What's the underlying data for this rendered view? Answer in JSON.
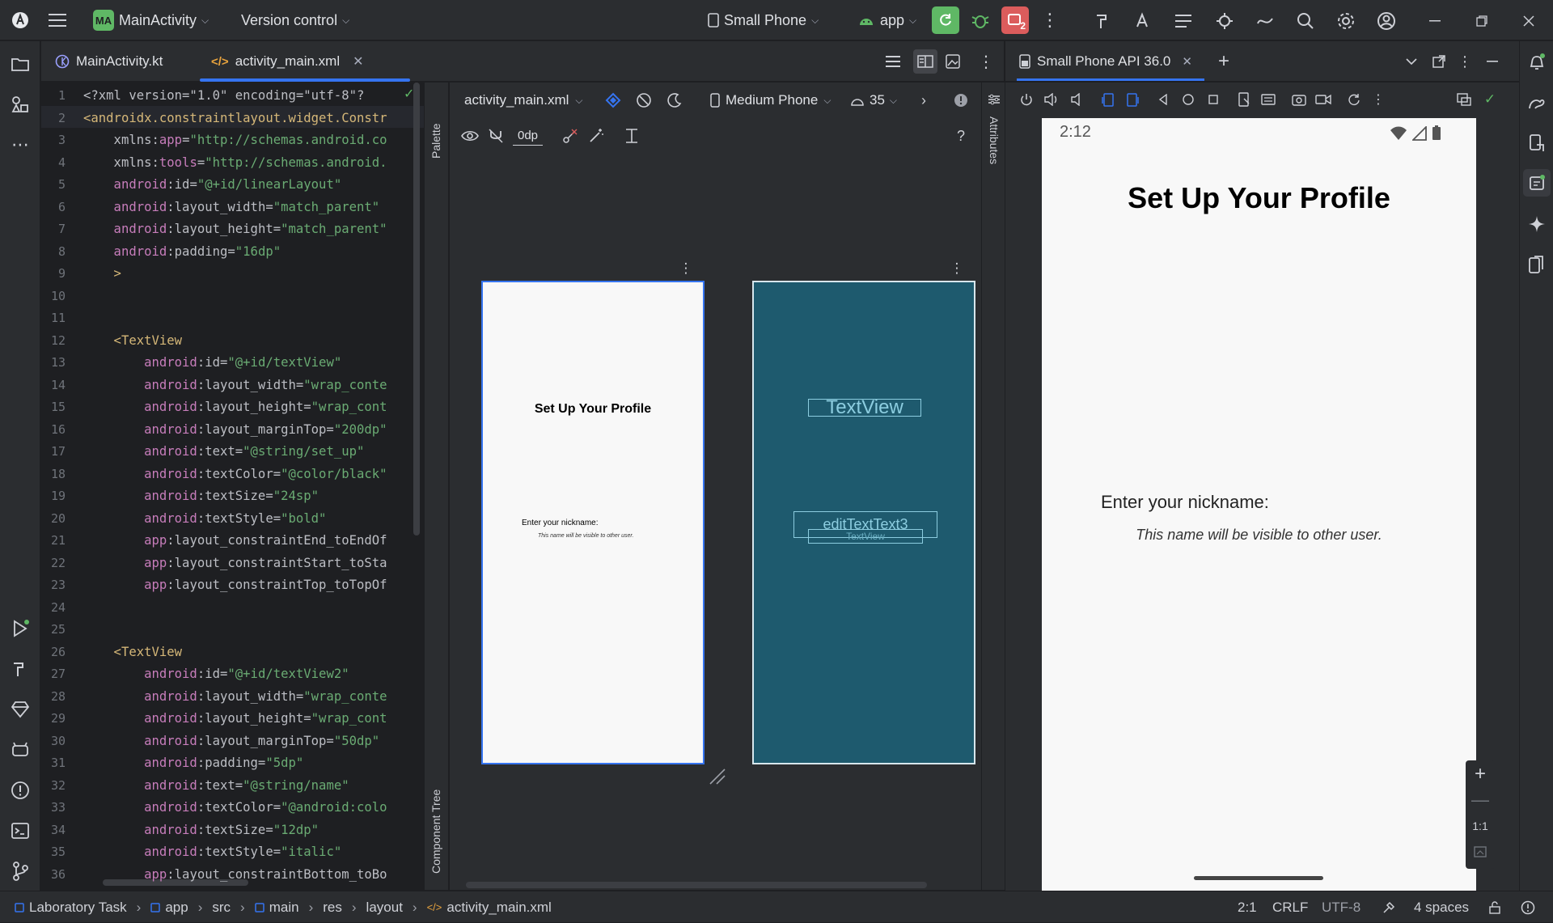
{
  "title_bar": {
    "project_badge": "MA",
    "project_name": "MainActivity",
    "vcs_label": "Version control",
    "device_label": "Small Phone",
    "run_config": "app",
    "notification_count": "2"
  },
  "editor_tabs": [
    {
      "label": "MainActivity.kt",
      "active": false
    },
    {
      "label": "activity_main.xml",
      "active": true
    }
  ],
  "code_lines": [
    {
      "n": "1",
      "parts": [
        [
          "p",
          "<?xml version=\"1.0\" encoding=\"utf-8\"?"
        ]
      ]
    },
    {
      "n": "2",
      "parts": [
        [
          "k",
          "<androidx.constraintlayout.widget.Constr"
        ]
      ]
    },
    {
      "n": "3",
      "parts": [
        [
          "p",
          "    xmlns:"
        ],
        [
          "a",
          "app"
        ],
        [
          "p",
          "="
        ],
        [
          "s",
          "\"http://schemas.android.co"
        ]
      ]
    },
    {
      "n": "4",
      "parts": [
        [
          "p",
          "    xmlns:"
        ],
        [
          "a",
          "tools"
        ],
        [
          "p",
          "="
        ],
        [
          "s",
          "\"http://schemas.android."
        ]
      ]
    },
    {
      "n": "5",
      "parts": [
        [
          "a",
          "    android"
        ],
        [
          "p",
          ":id="
        ],
        [
          "s",
          "\"@+id/linearLayout\""
        ]
      ]
    },
    {
      "n": "6",
      "parts": [
        [
          "a",
          "    android"
        ],
        [
          "p",
          ":layout_width="
        ],
        [
          "s",
          "\"match_parent\""
        ]
      ]
    },
    {
      "n": "7",
      "parts": [
        [
          "a",
          "    android"
        ],
        [
          "p",
          ":layout_height="
        ],
        [
          "s",
          "\"match_parent\""
        ]
      ]
    },
    {
      "n": "8",
      "parts": [
        [
          "a",
          "    android"
        ],
        [
          "p",
          ":padding="
        ],
        [
          "s",
          "\"16dp\""
        ]
      ]
    },
    {
      "n": "9",
      "parts": [
        [
          "k",
          "    >"
        ]
      ]
    },
    {
      "n": "10",
      "parts": []
    },
    {
      "n": "11",
      "parts": []
    },
    {
      "n": "12",
      "parts": [
        [
          "k",
          "    <TextView"
        ]
      ]
    },
    {
      "n": "13",
      "parts": [
        [
          "a",
          "        android"
        ],
        [
          "p",
          ":id="
        ],
        [
          "s",
          "\"@+id/textView\""
        ]
      ]
    },
    {
      "n": "14",
      "parts": [
        [
          "a",
          "        android"
        ],
        [
          "p",
          ":layout_width="
        ],
        [
          "s",
          "\"wrap_conte"
        ]
      ]
    },
    {
      "n": "15",
      "parts": [
        [
          "a",
          "        android"
        ],
        [
          "p",
          ":layout_height="
        ],
        [
          "s",
          "\"wrap_cont"
        ]
      ]
    },
    {
      "n": "16",
      "parts": [
        [
          "a",
          "        android"
        ],
        [
          "p",
          ":layout_marginTop="
        ],
        [
          "s",
          "\"200dp\""
        ]
      ]
    },
    {
      "n": "17",
      "parts": [
        [
          "a",
          "        android"
        ],
        [
          "p",
          ":text="
        ],
        [
          "s",
          "\"@string/set_up\""
        ]
      ]
    },
    {
      "n": "18",
      "parts": [
        [
          "a",
          "        android"
        ],
        [
          "p",
          ":textColor="
        ],
        [
          "s",
          "\"@color/black\""
        ]
      ]
    },
    {
      "n": "19",
      "parts": [
        [
          "a",
          "        android"
        ],
        [
          "p",
          ":textSize="
        ],
        [
          "s",
          "\"24sp\""
        ]
      ]
    },
    {
      "n": "20",
      "parts": [
        [
          "a",
          "        android"
        ],
        [
          "p",
          ":textStyle="
        ],
        [
          "s",
          "\"bold\""
        ]
      ]
    },
    {
      "n": "21",
      "parts": [
        [
          "a",
          "        app"
        ],
        [
          "p",
          ":layout_constraintEnd_toEndOf"
        ]
      ]
    },
    {
      "n": "22",
      "parts": [
        [
          "a",
          "        app"
        ],
        [
          "p",
          ":layout_constraintStart_toSta"
        ]
      ]
    },
    {
      "n": "23",
      "parts": [
        [
          "a",
          "        app"
        ],
        [
          "p",
          ":layout_constraintTop_toTopOf"
        ]
      ]
    },
    {
      "n": "24",
      "parts": []
    },
    {
      "n": "25",
      "parts": []
    },
    {
      "n": "26",
      "parts": [
        [
          "k",
          "    <TextView"
        ]
      ]
    },
    {
      "n": "27",
      "parts": [
        [
          "a",
          "        android"
        ],
        [
          "p",
          ":id="
        ],
        [
          "s",
          "\"@+id/textView2\""
        ]
      ]
    },
    {
      "n": "28",
      "parts": [
        [
          "a",
          "        android"
        ],
        [
          "p",
          ":layout_width="
        ],
        [
          "s",
          "\"wrap_conte"
        ]
      ]
    },
    {
      "n": "29",
      "parts": [
        [
          "a",
          "        android"
        ],
        [
          "p",
          ":layout_height="
        ],
        [
          "s",
          "\"wrap_cont"
        ]
      ]
    },
    {
      "n": "30",
      "parts": [
        [
          "a",
          "        android"
        ],
        [
          "p",
          ":layout_marginTop="
        ],
        [
          "s",
          "\"50dp\""
        ]
      ]
    },
    {
      "n": "31",
      "parts": [
        [
          "a",
          "        android"
        ],
        [
          "p",
          ":padding="
        ],
        [
          "s",
          "\"5dp\""
        ]
      ]
    },
    {
      "n": "32",
      "parts": [
        [
          "a",
          "        android"
        ],
        [
          "p",
          ":text="
        ],
        [
          "s",
          "\"@string/name\""
        ]
      ]
    },
    {
      "n": "33",
      "parts": [
        [
          "a",
          "        android"
        ],
        [
          "p",
          ":textColor="
        ],
        [
          "s",
          "\"@android:colo"
        ]
      ]
    },
    {
      "n": "34",
      "parts": [
        [
          "a",
          "        android"
        ],
        [
          "p",
          ":textSize="
        ],
        [
          "s",
          "\"12dp\""
        ]
      ]
    },
    {
      "n": "35",
      "parts": [
        [
          "a",
          "        android"
        ],
        [
          "p",
          ":textStyle="
        ],
        [
          "s",
          "\"italic\""
        ]
      ]
    },
    {
      "n": "36",
      "parts": [
        [
          "a",
          "        app"
        ],
        [
          "p",
          ":layout_constraintBottom_toBo"
        ]
      ]
    }
  ],
  "design_toolbar": {
    "file_label": "activity_main.xml",
    "device_label": "Medium Phone",
    "api_label": "35",
    "margin_value": "0dp",
    "help": "?"
  },
  "side_labels": {
    "palette": "Palette",
    "component_tree": "Component Tree",
    "attributes": "Attributes"
  },
  "design_preview": {
    "title": "Set Up Your Profile",
    "nickname": "Enter your nickname:",
    "hint": "This name will be visible to other user."
  },
  "blueprint": {
    "textview_label": "TextView",
    "edittext_label": "editTextText3",
    "textview2_label": "TextView"
  },
  "running_devices": {
    "tab_label": "Small Phone API 36.0"
  },
  "phone": {
    "time": "2:12",
    "title": "Set Up Your Profile",
    "nickname": "Enter your nickname:",
    "hint": "This name will be visible to other user.",
    "zoom_ratio": "1:1"
  },
  "status_bar": {
    "breadcrumbs": [
      "Laboratory Task",
      "app",
      "src",
      "main",
      "res",
      "layout",
      "activity_main.xml"
    ],
    "position": "2:1",
    "line_sep": "CRLF",
    "encoding": "UTF-8",
    "indent": "4 spaces"
  },
  "colors": {
    "accent": "#3574f0",
    "run_green": "#5fb865",
    "error_red": "#db5c5c",
    "blueprint_bg": "#1e5a6e"
  }
}
